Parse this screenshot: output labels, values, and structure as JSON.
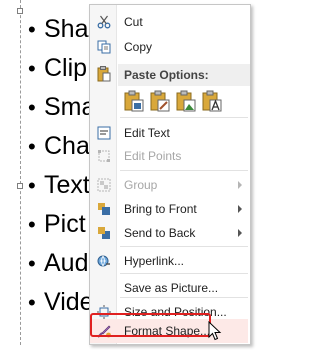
{
  "slide": {
    "bullets": [
      "Sha",
      "Clip",
      "Sma",
      "Cha",
      "Text",
      "Pict",
      "Aud",
      "Vide"
    ]
  },
  "context_menu": {
    "items": {
      "cut": {
        "label": "Cut",
        "icon": "scissors-icon"
      },
      "copy": {
        "label": "Copy",
        "icon": "copy-icon"
      },
      "paste_options": {
        "label": "Paste Options:",
        "icon": "clipboard-icon"
      },
      "edit_text": {
        "label": "Edit Text",
        "icon": "edit-text-icon"
      },
      "edit_points": {
        "label": "Edit Points",
        "icon": "edit-points-icon",
        "disabled": true
      },
      "group": {
        "label": "Group",
        "icon": "group-icon",
        "disabled": true
      },
      "bring_to_front": {
        "label": "Bring to Front",
        "icon": "bring-to-front-icon"
      },
      "send_to_back": {
        "label": "Send to Back",
        "icon": "send-to-back-icon"
      },
      "hyperlink": {
        "label": "Hyperlink...",
        "icon": "hyperlink-icon"
      },
      "save_as_picture": {
        "label": "Save as Picture..."
      },
      "size_and_position": {
        "label": "Size and Position...",
        "icon": "size-position-icon"
      },
      "format_shape": {
        "label": "Format Shape...",
        "icon": "format-shape-icon",
        "highlighted": true
      }
    },
    "paste_buttons": [
      "paste-use-destination-theme-icon",
      "paste-keep-source-formatting-icon",
      "paste-picture-icon",
      "paste-keep-text-only-icon"
    ]
  },
  "colors": {
    "highlight_border": "#e02020",
    "menu_background": "#ffffff",
    "disabled_text": "#a6a6a6",
    "paste_icon_yellow": "#d9a83b"
  }
}
